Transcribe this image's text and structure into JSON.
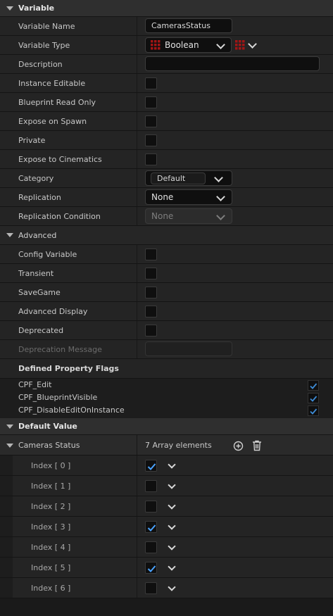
{
  "sections": {
    "variable": "Variable",
    "advanced": "Advanced",
    "default_value": "Default Value"
  },
  "variable": {
    "name_label": "Variable Name",
    "name_value": "CamerasStatus",
    "type_label": "Variable Type",
    "type_value": "Boolean",
    "description_label": "Description",
    "description_value": "",
    "instance_editable": "Instance Editable",
    "blueprint_read_only": "Blueprint Read Only",
    "expose_on_spawn": "Expose on Spawn",
    "private": "Private",
    "expose_to_cinematics": "Expose to Cinematics",
    "category_label": "Category",
    "category_value": "Default",
    "replication_label": "Replication",
    "replication_value": "None",
    "replication_condition_label": "Replication Condition",
    "replication_condition_value": "None"
  },
  "advanced": {
    "config_variable": "Config Variable",
    "transient": "Transient",
    "savegame": "SaveGame",
    "advanced_display": "Advanced Display",
    "deprecated": "Deprecated",
    "deprecation_message": "Deprecation Message",
    "defined_property_flags": "Defined Property Flags",
    "flags": [
      "CPF_Edit",
      "CPF_BlueprintVisible",
      "CPF_DisableEditOnInstance"
    ]
  },
  "default_value": {
    "cameras_status_label": "Cameras Status",
    "array_count": "7 Array elements",
    "elements": [
      {
        "label": "Index [ 0 ]",
        "checked": true
      },
      {
        "label": "Index [ 1 ]",
        "checked": false
      },
      {
        "label": "Index [ 2 ]",
        "checked": false
      },
      {
        "label": "Index [ 3 ]",
        "checked": true
      },
      {
        "label": "Index [ 4 ]",
        "checked": false
      },
      {
        "label": "Index [ 5 ]",
        "checked": true
      },
      {
        "label": "Index [ 6 ]",
        "checked": false
      }
    ]
  },
  "colors": {
    "boolean_pin": "#9b1010",
    "check": "#4aa3ff",
    "panel_bg": "#242424",
    "header_bg": "#2f2f2f"
  },
  "icons": {
    "type_grid": "grid-icon",
    "add": "plus-circle-icon",
    "delete": "trash-icon",
    "expand": "chevron-down-icon",
    "collapse_section": "triangle-down-icon"
  }
}
